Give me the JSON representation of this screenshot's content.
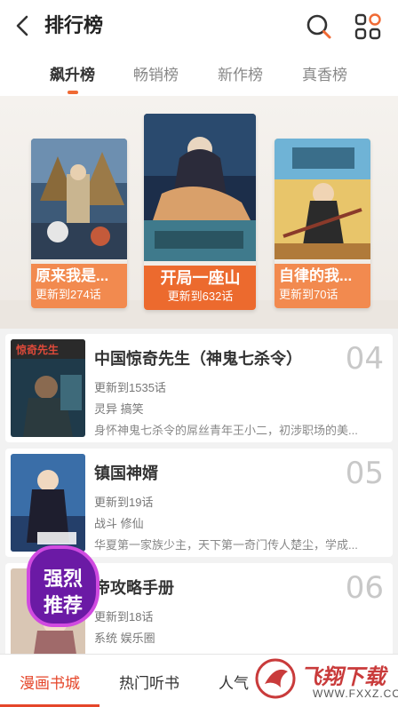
{
  "header": {
    "title": "排行榜"
  },
  "tabs": [
    {
      "label": "飙升榜"
    },
    {
      "label": "畅销榜"
    },
    {
      "label": "新作榜"
    },
    {
      "label": "真香榜"
    }
  ],
  "podium": [
    {
      "name": "原来我是...",
      "update": "更新到274话"
    },
    {
      "name": "开局一座山",
      "update": "更新到632话"
    },
    {
      "name": "自律的我...",
      "update": "更新到70话"
    }
  ],
  "list": [
    {
      "title": "中国惊奇先生（神鬼七杀令）",
      "update": "更新到1535话",
      "tags": "灵异 搞笑",
      "desc": "身怀神鬼七杀令的屌丝青年王小二，初涉职场的美...",
      "rank": "04"
    },
    {
      "title": "镇国神婿",
      "update": "更新到19话",
      "tags": "战斗 修仙",
      "desc": "华夏第一家族少主，天下第一奇门传人楚尘，学成...",
      "rank": "05"
    },
    {
      "title": "帝攻略手册",
      "update": "更新到18话",
      "tags": "系统 娱乐圈",
      "desc": "",
      "rank": "06"
    }
  ],
  "promo": {
    "line1": "强烈",
    "line2": "推荐"
  },
  "bottom_nav": [
    {
      "label": "漫画书城"
    },
    {
      "label": "热门听书"
    },
    {
      "label": "人气"
    }
  ],
  "watermark": {
    "text": "飞翔下载",
    "url": "WWW.FXXZ.COM"
  },
  "colors": {
    "accent": "#f06a34",
    "nav_active": "#e5462a",
    "promo": "#6b1aa5"
  }
}
